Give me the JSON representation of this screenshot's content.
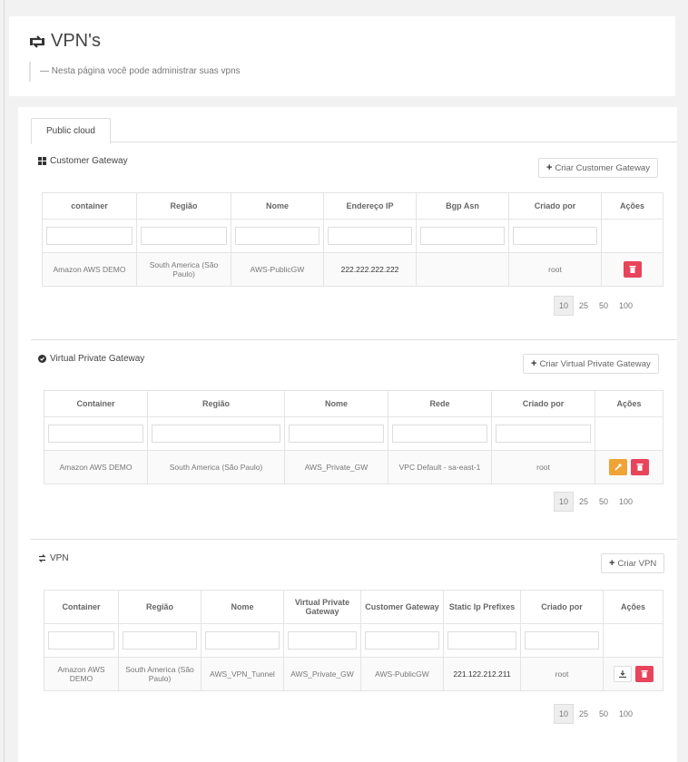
{
  "page": {
    "title": "VPN's",
    "subtitle": "Nesta página você pode administrar suas vpns"
  },
  "tabs": [
    {
      "label": "Public cloud"
    }
  ],
  "customer_gateway": {
    "title": "Customer Gateway",
    "create_label": "Criar Customer Gateway",
    "columns": [
      "container",
      "Região",
      "Nome",
      "Endereço IP",
      "Bgp Asn",
      "Criado por",
      "Ações"
    ],
    "rows": [
      {
        "container": "Amazon AWS DEMO",
        "regiao": "South America (São Paulo)",
        "nome": "AWS-PublicGW",
        "ip": "222.222.222.222",
        "bgp": "",
        "criado_por": "root"
      }
    ],
    "pagination": [
      "10",
      "25",
      "50",
      "100"
    ]
  },
  "virtual_private_gateway": {
    "title": "Virtual Private Gateway",
    "create_label": "Criar Virtual Private Gateway",
    "columns": [
      "Container",
      "Região",
      "Nome",
      "Rede",
      "Criado por",
      "Ações"
    ],
    "rows": [
      {
        "container": "Amazon AWS DEMO",
        "regiao": "South America (São Paulo)",
        "nome": "AWS_Private_GW",
        "rede": "VPC Default - sa-east-1",
        "criado_por": "root"
      }
    ],
    "pagination": [
      "10",
      "25",
      "50",
      "100"
    ]
  },
  "vpn": {
    "title": "VPN",
    "create_label": "Criar VPN",
    "columns": [
      "Container",
      "Região",
      "Nome",
      "Virtual Private Gateway",
      "Customer Gateway",
      "Static Ip Prefixes",
      "Criado por",
      "Ações"
    ],
    "rows": [
      {
        "container": "Amazon AWS DEMO",
        "regiao": "South America (São Paulo)",
        "nome": "AWS_VPN_Tunnel",
        "vpg": "AWS_Private_GW",
        "cgw": "AWS-PublicGW",
        "prefixes": "221.122.212.211",
        "criado_por": "root"
      }
    ],
    "pagination": [
      "10",
      "25",
      "50",
      "100"
    ]
  },
  "colors": {
    "delete": "#e8445b",
    "edit": "#f0a336"
  },
  "icons": [
    "exchange-icon",
    "grid-icon",
    "circle-icon",
    "plus-icon",
    "trash-icon",
    "wrench-icon",
    "download-icon"
  ]
}
